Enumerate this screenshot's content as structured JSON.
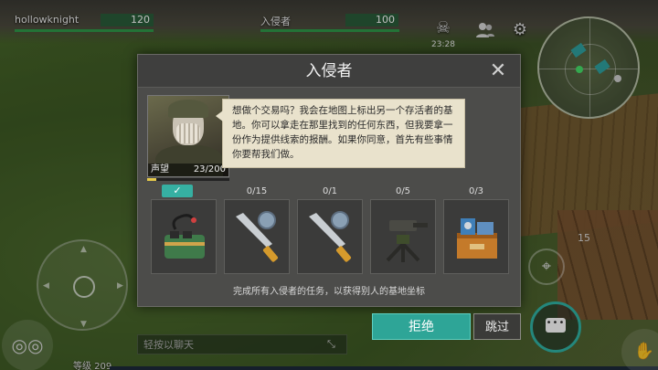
{
  "hud": {
    "player": {
      "name": "hollowknight",
      "value": "120"
    },
    "enemy": {
      "name": "入侵者",
      "value": "100"
    },
    "time": "23:28",
    "icons": {
      "skull": "skull-icon",
      "people": "people-icon",
      "settings": "gear-icon"
    }
  },
  "modal": {
    "title": "入侵者",
    "close": "✕",
    "portrait": {
      "reputation_label": "声望",
      "reputation_value": "23/200",
      "reputation_fraction": 0.115
    },
    "dialog": "想做个交易吗？我会在地图上标出另一个存活者的基地。你可以拿走在那里找到的任何东西，但我要拿一份作为提供线索的报酬。如果你同意，首先有些事情你要帮我们做。",
    "rewards": [
      {
        "icon": "dynamite-icon",
        "count": "✓",
        "done": true
      },
      {
        "icon": "machete-icon",
        "count": "0/15",
        "done": false
      },
      {
        "icon": "machete-icon",
        "count": "0/1",
        "done": false
      },
      {
        "icon": "turret-icon",
        "count": "0/5",
        "done": false
      },
      {
        "icon": "supply-crate-icon",
        "count": "0/3",
        "done": false
      }
    ],
    "footer": "完成所有入侵者的任务，以获得别人的基地坐标"
  },
  "actions": {
    "reject": "拒绝",
    "skip": "跳过"
  },
  "bottom": {
    "level": "等级 209",
    "chat_placeholder": "轻按以聊天",
    "right_num": "15"
  },
  "colors": {
    "accent": "#2ea597",
    "panel": "#4c4c4a",
    "dialog": "#e9e2cc",
    "hp": "#2f9a4a"
  }
}
